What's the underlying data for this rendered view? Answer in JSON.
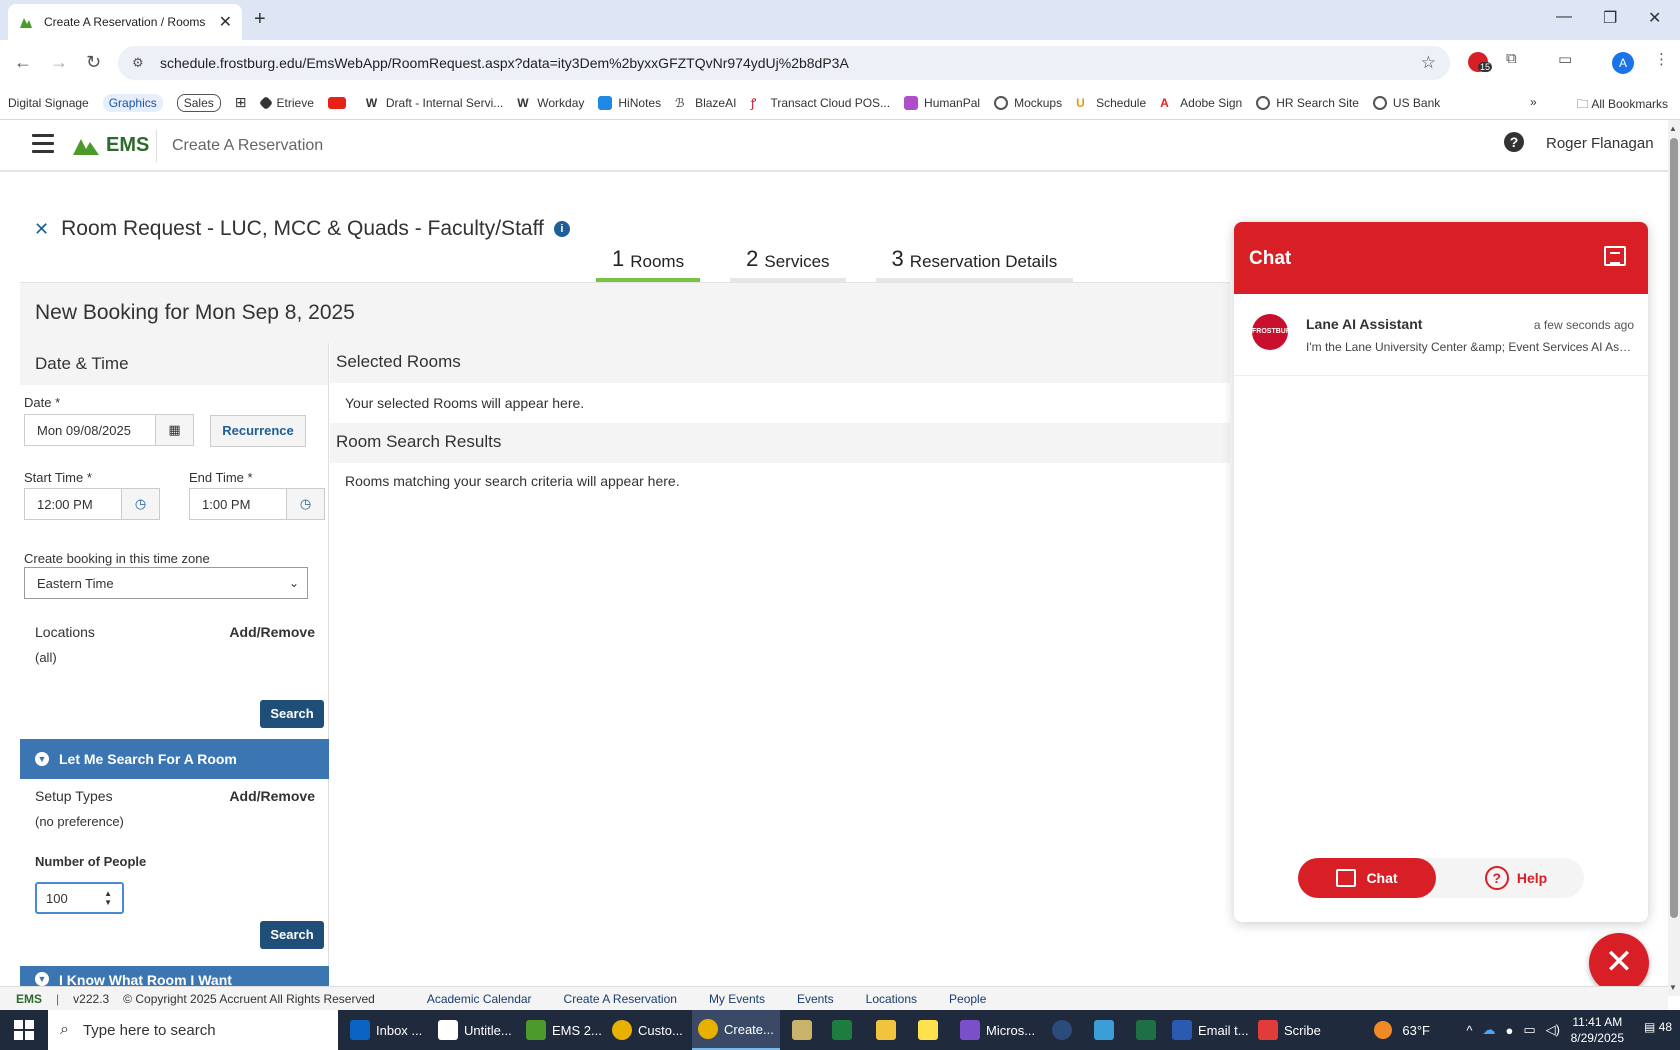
{
  "browser": {
    "tab_title": "Create A Reservation / Rooms",
    "url": "schedule.frostburg.edu/EmsWebApp/RoomRequest.aspx?data=ity3Dem%2byxxGFZTQvNr974ydUj%2b8dP3A",
    "ext_badge": "15",
    "profile_initial": "A",
    "bookmarks": [
      "Digital Signage",
      "Graphics",
      "Sales",
      "Etrieve",
      "Draft - Internal Servi...",
      "Workday",
      "HiNotes",
      "BlazeAI",
      "Transact Cloud POS...",
      "HumanPal",
      "Mockups",
      "Schedule",
      "Adobe Sign",
      "HR Search Site",
      "US Bank"
    ],
    "all_bookmarks": "All Bookmarks",
    "more": "»"
  },
  "header": {
    "logo": "EMS",
    "title": "Create A Reservation",
    "help": "?",
    "user": "Roger Flanagan"
  },
  "request": {
    "close": "✕",
    "title": "Room Request - LUC, MCC & Quads - Faculty/Staff",
    "info": "i"
  },
  "steps": [
    {
      "num": "1",
      "label": "Rooms"
    },
    {
      "num": "2",
      "label": "Services"
    },
    {
      "num": "3",
      "label": "Reservation Details"
    }
  ],
  "booking": {
    "heading": "New Booking for Mon Sep 8, 2025",
    "date_time_heading": "Date & Time",
    "date_label": "Date *",
    "date_value": "Mon 09/08/2025",
    "recurrence": "Recurrence",
    "start_label": "Start Time *",
    "start_value": "12:00 PM",
    "end_label": "End Time *",
    "end_value": "1:00 PM",
    "tz_label": "Create booking in this time zone",
    "tz_value": "Eastern Time",
    "locations_label": "Locations",
    "locations_link": "Add/Remove",
    "locations_value": "(all)",
    "search": "Search",
    "let_me_search": "Let Me Search For A Room",
    "setup_label": "Setup Types",
    "setup_link": "Add/Remove",
    "setup_value": "(no preference)",
    "people_label": "Number of People",
    "people_value": "100",
    "search2": "Search",
    "know_room": "I Know What Room I Want"
  },
  "results": {
    "selected_heading": "Selected Rooms",
    "selected_note": "Your selected Rooms will appear here.",
    "search_heading": "Room Search Results",
    "search_note": "Rooms matching your search criteria will appear here."
  },
  "chat": {
    "title": "Chat",
    "sender": "Lane AI Assistant",
    "time": "a few seconds ago",
    "message": "I'm the Lane University Center &amp; Event Services AI Assis...",
    "avatar_text": "FROSTBURG",
    "tab_chat": "Chat",
    "tab_help": "Help",
    "close": "✕"
  },
  "footer": {
    "logo": "EMS",
    "version": "v222.3",
    "copyright": "© Copyright 2025 Accruent All Rights Reserved",
    "links": [
      "Academic Calendar",
      "Create A Reservation",
      "My Events",
      "Events",
      "Locations",
      "People"
    ]
  },
  "taskbar": {
    "search": "Type here to search",
    "apps": [
      "Inbox ...",
      "Untitle...",
      "EMS 2...",
      "Custo...",
      "Create...",
      "Micros...",
      "Email t...",
      "Scribe"
    ],
    "weather": "63°F",
    "time": "11:41 AM",
    "date": "8/29/2025",
    "notifications": "48"
  }
}
